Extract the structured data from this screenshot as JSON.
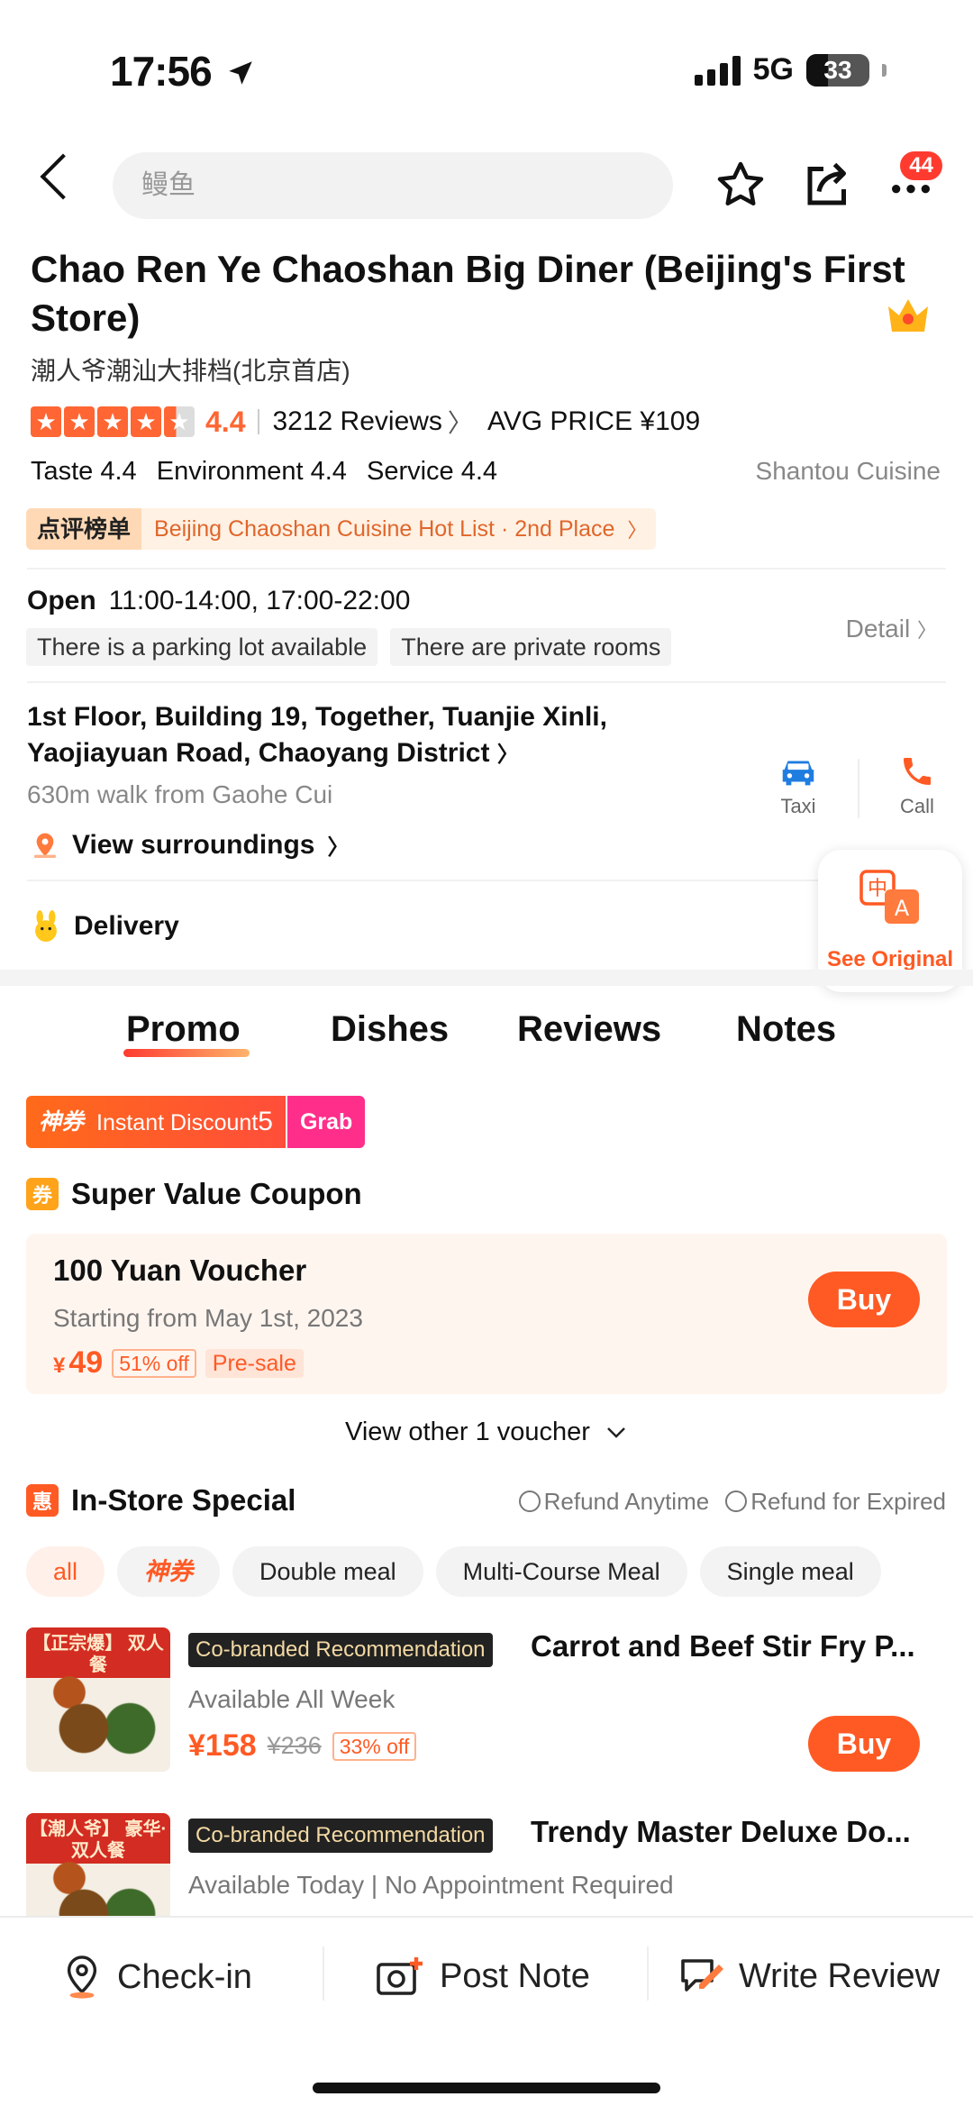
{
  "status": {
    "time": "17:56",
    "network": "5G",
    "battery": "33"
  },
  "nav": {
    "search_placeholder": "鳗鱼",
    "more_badge": "44"
  },
  "restaurant": {
    "name": "Chao Ren Ye Chaoshan Big Diner (Beijing's First Store)",
    "native_name": "潮人爷潮汕大排档(北京首店)",
    "rating": "4.4",
    "reviews": "3212 Reviews",
    "avg_price": "AVG PRICE ¥109",
    "taste": "Taste 4.4",
    "environment": "Environment 4.4",
    "service": "Service 4.4",
    "cuisine": "Shantou Cuisine",
    "hotlist_tag": "点评榜单",
    "hotlist_text": "Beijing Chaoshan Cuisine Hot List · 2nd Place",
    "open_label": "Open",
    "hours": "11:00-14:00, 17:00-22:00",
    "facilities": [
      "There is a parking lot available",
      "There are private rooms"
    ],
    "detail_label": "Detail",
    "address": "1st Floor, Building 19, Together, Tuanjie Xinli, Yaojiayuan Road, Chaoyang District",
    "walk": "630m walk from Gaohe Cui",
    "taxi_label": "Taxi",
    "call_label": "Call",
    "surroundings_label": "View surroundings",
    "delivery_label": "Delivery",
    "translate_label": "See Original"
  },
  "tabs": [
    "Promo",
    "Dishes",
    "Reviews",
    "Notes"
  ],
  "instant": {
    "tag": "神券",
    "label": "Instant Discount",
    "amount": "5",
    "grab": "Grab"
  },
  "coupon_section": {
    "icon": "券",
    "title": "Super Value Coupon",
    "voucher_name": "100 Yuan Voucher",
    "voucher_date": "Starting from May 1st, 2023",
    "currency": "¥",
    "price": "49",
    "discount": "51% off",
    "presale": "Pre-sale",
    "buy_label": "Buy",
    "view_other": "View other 1 voucher"
  },
  "instore": {
    "icon": "惠",
    "title": "In-Store Special",
    "refund_anytime": "Refund Anytime",
    "refund_expired": "Refund for Expired",
    "filters": [
      "all",
      "神券",
      "Double meal",
      "Multi-Course Meal",
      "Single meal"
    ],
    "deals": [
      {
        "image_text": "【正宗爆】 双人餐",
        "brand": "Co-branded Recommendation",
        "name": "Carrot and Beef Stir Fry P...",
        "availability": "Available All Week",
        "price": "¥158",
        "original": "¥236",
        "discount": "33% off",
        "buy_label": "Buy"
      },
      {
        "image_text": "【潮人爷】 豪华·双人餐",
        "brand": "Co-branded Recommendation",
        "name": "Trendy Master Deluxe Do...",
        "availability": "Available Today | No Appointment Required"
      }
    ]
  },
  "bottom_bar": {
    "checkin": "Check-in",
    "post_note": "Post Note",
    "write_review": "Write Review"
  },
  "colors": {
    "accent": "#ff5a24",
    "star": "#ff6633",
    "brand_pink": "#ff2e8a"
  }
}
